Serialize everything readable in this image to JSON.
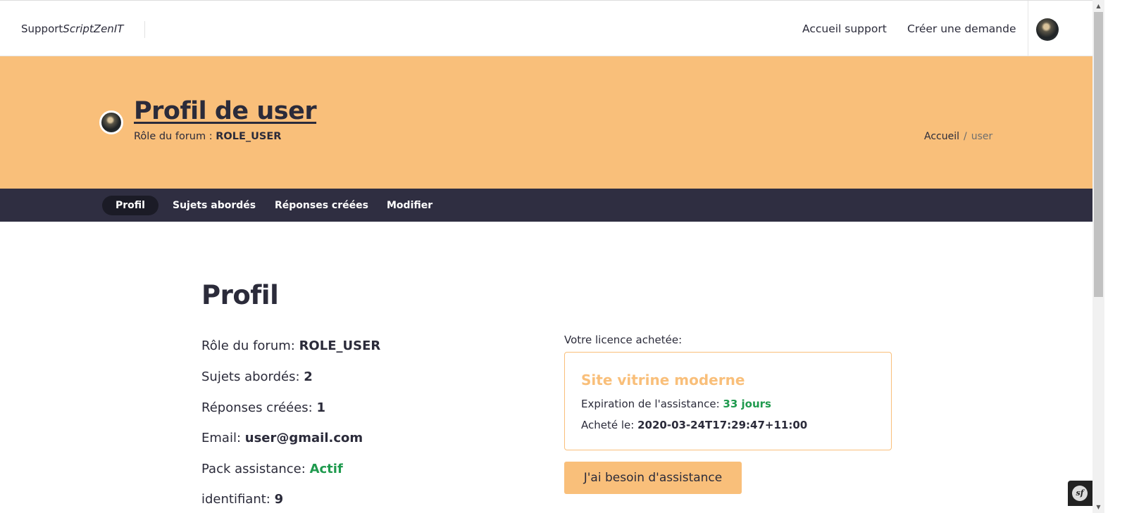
{
  "navbar": {
    "brand_main": "Support",
    "brand_em": "ScriptZenIT",
    "links": {
      "home": "Accueil support",
      "create": "Créer une demande"
    }
  },
  "hero": {
    "title": "Profil de user",
    "role_label": "Rôle du forum :",
    "role_value": "ROLE_USER",
    "breadcrumb": {
      "home": "Accueil",
      "separator": "/",
      "current": "user"
    }
  },
  "tabs": [
    {
      "label": "Profil",
      "active": true
    },
    {
      "label": "Sujets abordés",
      "active": false
    },
    {
      "label": "Réponses créées",
      "active": false
    },
    {
      "label": "Modifier",
      "active": false
    }
  ],
  "profile": {
    "title": "Profil",
    "rows": {
      "role": {
        "label": "Rôle du forum:",
        "value": "ROLE_USER"
      },
      "sujets": {
        "label": "Sujets abordés:",
        "value": "2"
      },
      "reponses": {
        "label": "Réponses créées:",
        "value": "1"
      },
      "email": {
        "label": "Email:",
        "value": "user@gmail.com"
      },
      "pack": {
        "label": "Pack assistance:",
        "value": "Actif"
      },
      "identifiant": {
        "label": "identifiant:",
        "value": "9"
      }
    }
  },
  "licence": {
    "label": "Votre licence achetée:",
    "name": "Site vitrine moderne",
    "expiration_label": "Expiration de l'assistance:",
    "expiration_value": "33 jours",
    "bought_label": "Acheté le:",
    "bought_value": "2020-03-24T17:29:47+11:00",
    "button": "J'ai besoin d'assistance"
  },
  "debug_toolbar": {
    "logo": "sf"
  },
  "colors": {
    "accent": "#f9bf7a",
    "dark": "#2f2e41",
    "success": "#1f9a4e",
    "text": "#2b2b3a"
  }
}
